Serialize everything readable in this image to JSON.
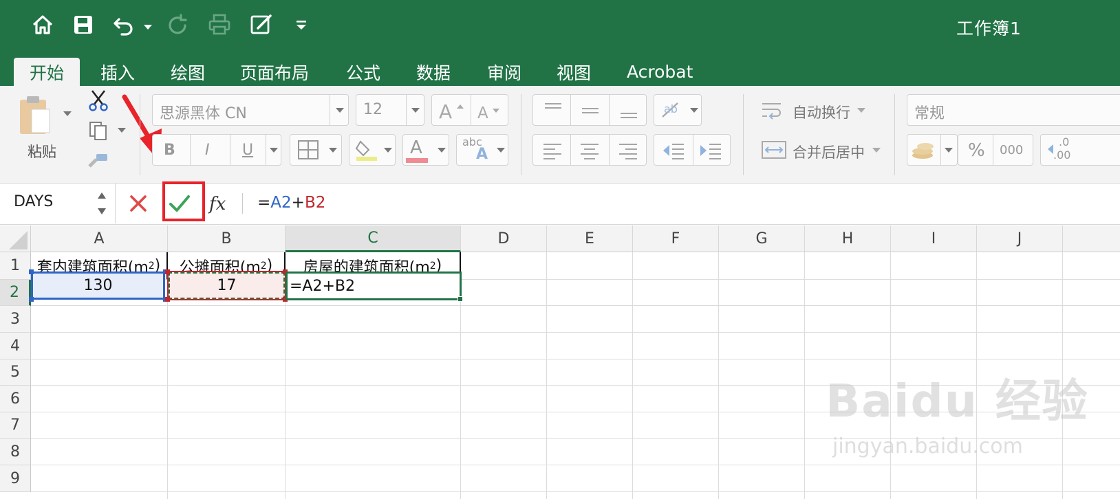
{
  "window": {
    "title": "工作簿1"
  },
  "quick_access": {
    "icons": [
      "home-icon",
      "save-icon",
      "undo-icon",
      "redo-icon",
      "print-icon",
      "edit-sign-icon",
      "customize-icon"
    ]
  },
  "tabs": [
    {
      "label": "开始",
      "active": true
    },
    {
      "label": "插入"
    },
    {
      "label": "绘图"
    },
    {
      "label": "页面布局"
    },
    {
      "label": "公式"
    },
    {
      "label": "数据"
    },
    {
      "label": "审阅"
    },
    {
      "label": "视图"
    },
    {
      "label": "Acrobat"
    }
  ],
  "ribbon": {
    "paste_label": "粘贴",
    "font_name": "思源黑体 CN",
    "font_size": "12",
    "bold": "B",
    "italic": "I",
    "underline": "U",
    "font_color_letter": "A",
    "text_style": "abc",
    "wrap_text": "自动换行",
    "merge_center": "合并后居中",
    "number_format": "常规",
    "percent": "%",
    "thousands": "000",
    "decimal_increase": ".0",
    "decimal_decrease": ".00"
  },
  "formula_bar": {
    "name_box": "DAYS",
    "formula_prefix": "=",
    "ref_a": "A2",
    "operator": "+",
    "ref_b": "B2"
  },
  "sheet": {
    "columns": [
      "A",
      "B",
      "C",
      "D",
      "E",
      "F",
      "G",
      "H",
      "I",
      "J"
    ],
    "rows": [
      "1",
      "2",
      "3",
      "4",
      "5",
      "6",
      "7",
      "8",
      "9"
    ],
    "headers": {
      "a1": "套内建筑面积(m",
      "b1": "公摊面积(m",
      "c1": "房屋的建筑面积(m",
      "superscript": "2",
      "close_paren": ")"
    },
    "values": {
      "a2": "130",
      "b2": "17",
      "c2": "=A2+B2"
    }
  },
  "colors": {
    "ribbon_green": "#217346",
    "ref_a_blue": "#2e64c7",
    "ref_b_red": "#c0262c",
    "annotation_red": "#e8232a"
  },
  "watermark": {
    "brand": "Bai",
    "brand_b": "du",
    "cn": "经验",
    "url": "jingyan.baidu.com"
  }
}
